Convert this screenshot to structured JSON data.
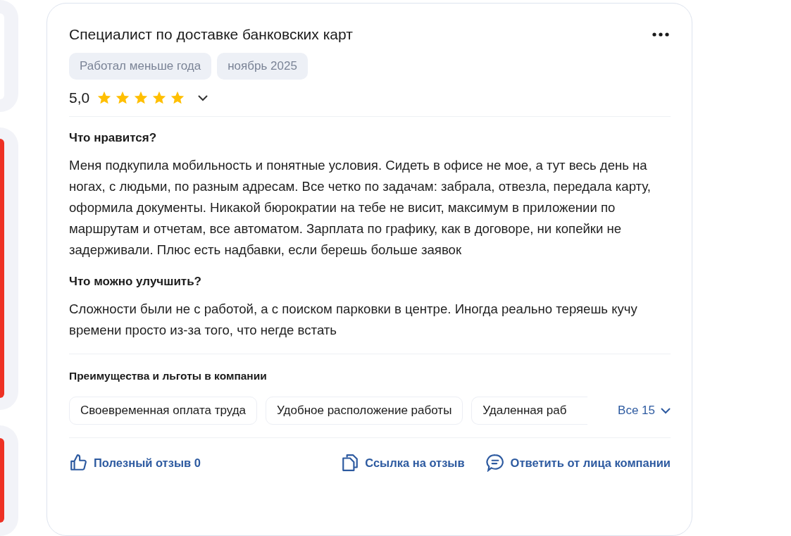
{
  "review": {
    "title": "Специалист по доставке банковских карт",
    "tags": [
      "Работал меньше года",
      "ноябрь 2025"
    ],
    "rating": {
      "value": "5,0",
      "stars": 5,
      "expanded": false
    },
    "sections": [
      {
        "heading": "Что нравится?",
        "text": "Меня подкупила мобильность и понятные условия. Сидеть в офисе не мое, а тут весь день на ногах, с людьми, по разным адресам. Все четко по задачам: забрала, отвезла, передала карту, оформила документы. Никакой бюрократии на тебе не висит, максимум в приложении по маршрутам и отчетам, все автоматом. Зарплата по графику, как в договоре, ни копейки не задерживали. Плюс есть надбавки, если берешь больше заявок"
      },
      {
        "heading": "Что можно улучшить?",
        "text": "Сложности были не с работой, а с поиском парковки в центре. Иногда реально теряешь кучу времени просто из-за того, что негде встать"
      }
    ],
    "benefits": {
      "heading": "Преимущества и льготы в компании",
      "items": [
        "Своевременная оплата труда",
        "Удобное расположение работы",
        "Удаленная раб"
      ],
      "show_all": "Все 15"
    },
    "actions": [
      {
        "kind": "like",
        "label": "Полезный отзыв 0"
      },
      {
        "kind": "link",
        "label": "Ссылка на отзыв"
      },
      {
        "kind": "reply",
        "label": "Ответить от лица компании"
      }
    ]
  }
}
